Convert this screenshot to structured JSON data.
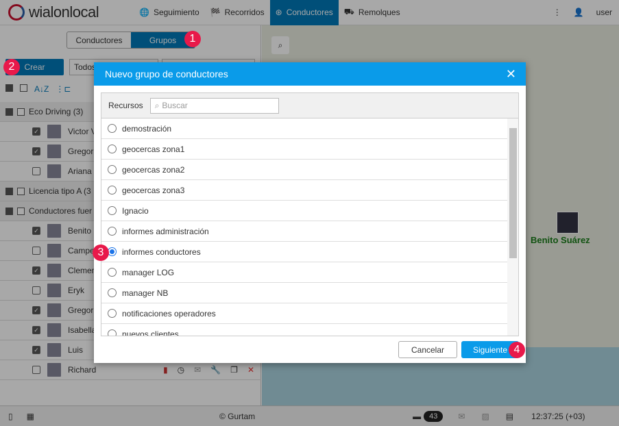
{
  "header": {
    "logo": "wialonlocal",
    "nav": [
      {
        "label": "Seguimiento",
        "icon": "globe-icon"
      },
      {
        "label": "Recorridos",
        "icon": "flag-icon"
      },
      {
        "label": "Conductores",
        "icon": "steering-icon",
        "active": true
      },
      {
        "label": "Remolques",
        "icon": "trailer-icon"
      }
    ],
    "user": "user"
  },
  "left": {
    "tabs": [
      "Conductores",
      "Grupos"
    ],
    "active_tab": "Grupos",
    "create": "Crear",
    "filter": "Todos",
    "groups": [
      {
        "name": "Eco Driving (3)",
        "expanded": true,
        "drivers": [
          {
            "name": "Victor V",
            "checked": true
          },
          {
            "name": "Gregori",
            "checked": true
          },
          {
            "name": "Ariana",
            "checked": false
          }
        ]
      },
      {
        "name": "Licencia tipo A (3",
        "expanded": false,
        "drivers": []
      },
      {
        "name": "Conductores fuer",
        "expanded": true,
        "drivers": [
          {
            "name": "Benito S",
            "checked": true
          },
          {
            "name": "Campe",
            "checked": false
          },
          {
            "name": "Clemer",
            "checked": true
          },
          {
            "name": "Eryk",
            "checked": false
          },
          {
            "name": "Gregori",
            "checked": true
          },
          {
            "name": "Isabella",
            "checked": true
          },
          {
            "name": "Luis",
            "checked": true
          },
          {
            "name": "Richard",
            "checked": false
          }
        ]
      }
    ]
  },
  "map": {
    "marker_label": "Benito Suárez"
  },
  "modal": {
    "title": "Nuevo grupo de conductores",
    "resources_label": "Recursos",
    "search_placeholder": "Buscar",
    "items": [
      {
        "label": "demostración",
        "selected": false
      },
      {
        "label": "geocercas zona1",
        "selected": false
      },
      {
        "label": "geocercas zona2",
        "selected": false
      },
      {
        "label": "geocercas zona3",
        "selected": false
      },
      {
        "label": "Ignacio",
        "selected": false
      },
      {
        "label": "informes administración",
        "selected": false
      },
      {
        "label": "informes conductores",
        "selected": true
      },
      {
        "label": "manager LOG",
        "selected": false
      },
      {
        "label": "manager NB",
        "selected": false
      },
      {
        "label": "notificaciones operadores",
        "selected": false
      },
      {
        "label": "nuevos clientes",
        "selected": false
      }
    ],
    "cancel": "Cancelar",
    "next": "Siguiente"
  },
  "footer": {
    "copyright": "© Gurtam",
    "count": "43",
    "time": "12:37:25 (+03)"
  },
  "steps": [
    "1",
    "2",
    "3",
    "4"
  ]
}
